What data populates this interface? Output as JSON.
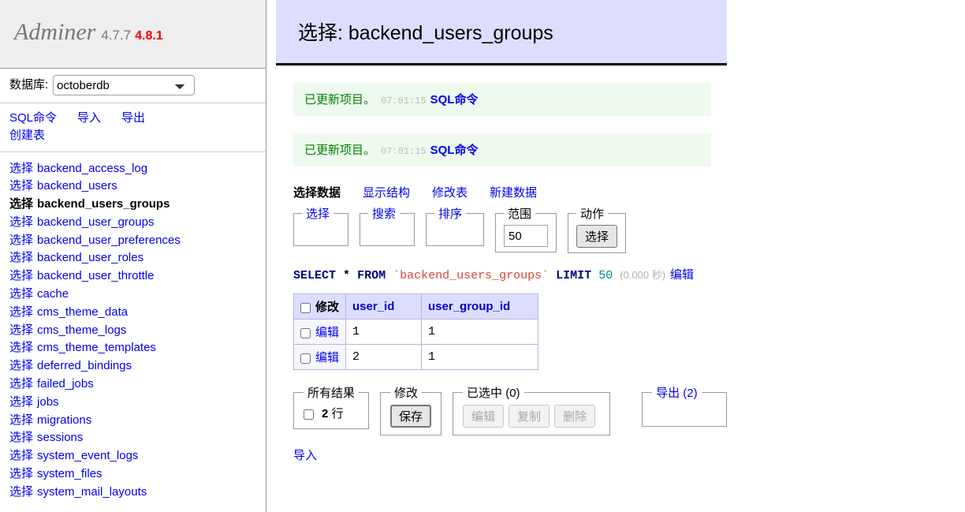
{
  "sidebar": {
    "brand": {
      "name": "Adminer",
      "version": "4.7.7",
      "latest_version": "4.8.1"
    },
    "database": {
      "label": "数据库:",
      "selected": "octoberdb",
      "options": [
        "octoberdb"
      ]
    },
    "links": [
      {
        "label": "SQL命令"
      },
      {
        "label": "导入"
      },
      {
        "label": "导出"
      },
      {
        "label": "创建表"
      }
    ],
    "select_label": "选择",
    "tables": [
      {
        "name": "backend_access_log",
        "current": false
      },
      {
        "name": "backend_users",
        "current": false
      },
      {
        "name": "backend_users_groups",
        "current": true
      },
      {
        "name": "backend_user_groups",
        "current": false
      },
      {
        "name": "backend_user_preferences",
        "current": false
      },
      {
        "name": "backend_user_roles",
        "current": false
      },
      {
        "name": "backend_user_throttle",
        "current": false
      },
      {
        "name": "cache",
        "current": false
      },
      {
        "name": "cms_theme_data",
        "current": false
      },
      {
        "name": "cms_theme_logs",
        "current": false
      },
      {
        "name": "cms_theme_templates",
        "current": false
      },
      {
        "name": "deferred_bindings",
        "current": false
      },
      {
        "name": "failed_jobs",
        "current": false
      },
      {
        "name": "jobs",
        "current": false
      },
      {
        "name": "migrations",
        "current": false
      },
      {
        "name": "sessions",
        "current": false
      },
      {
        "name": "system_event_logs",
        "current": false
      },
      {
        "name": "system_files",
        "current": false
      },
      {
        "name": "system_mail_layouts",
        "current": false
      }
    ]
  },
  "main": {
    "title": "选择: backend_users_groups",
    "messages": [
      {
        "text": "已更新项目。",
        "time": "07:01:15",
        "link": "SQL命令"
      },
      {
        "text": "已更新项目。",
        "time": "07:01:15",
        "link": "SQL命令"
      }
    ],
    "tabs": [
      {
        "label": "选择数据",
        "active": true
      },
      {
        "label": "显示结构",
        "active": false
      },
      {
        "label": "修改表",
        "active": false
      },
      {
        "label": "新建数据",
        "active": false
      }
    ],
    "filters": {
      "select_legend": "选择",
      "search_legend": "搜索",
      "sort_legend": "排序",
      "limit_legend": "范围",
      "limit_value": "50",
      "action_legend": "动作",
      "action_button": "选择"
    },
    "sql": {
      "keyword_select": "SELECT",
      "star": "*",
      "keyword_from": "FROM",
      "table": "`backend_users_groups`",
      "keyword_limit": "LIMIT",
      "limit": "50",
      "took": "(0.000 秒)",
      "edit_link": "编辑"
    },
    "table": {
      "modify_header": "修改",
      "columns": [
        "user_id",
        "user_group_id"
      ],
      "edit_label": "编辑",
      "rows": [
        {
          "user_id": "1",
          "user_group_id": "1"
        },
        {
          "user_id": "2",
          "user_group_id": "1"
        }
      ]
    },
    "footer": {
      "all_results_legend": "所有结果",
      "row_count": "2",
      "row_unit": "行",
      "modify_legend": "修改",
      "save_button": "保存",
      "selected_legend": "已选中 (0)",
      "selected_buttons": [
        "编辑",
        "复制",
        "删除"
      ],
      "export_legend": "导出 (2)",
      "import_link": "导入"
    }
  },
  "colors": {
    "link": "#0000ee",
    "title_bg": "#ddddff",
    "message_bg": "#effaef",
    "message_text": "#008000",
    "version_new": "#ee0000",
    "sql_keyword": "#000080",
    "sql_table": "#dd4433"
  }
}
